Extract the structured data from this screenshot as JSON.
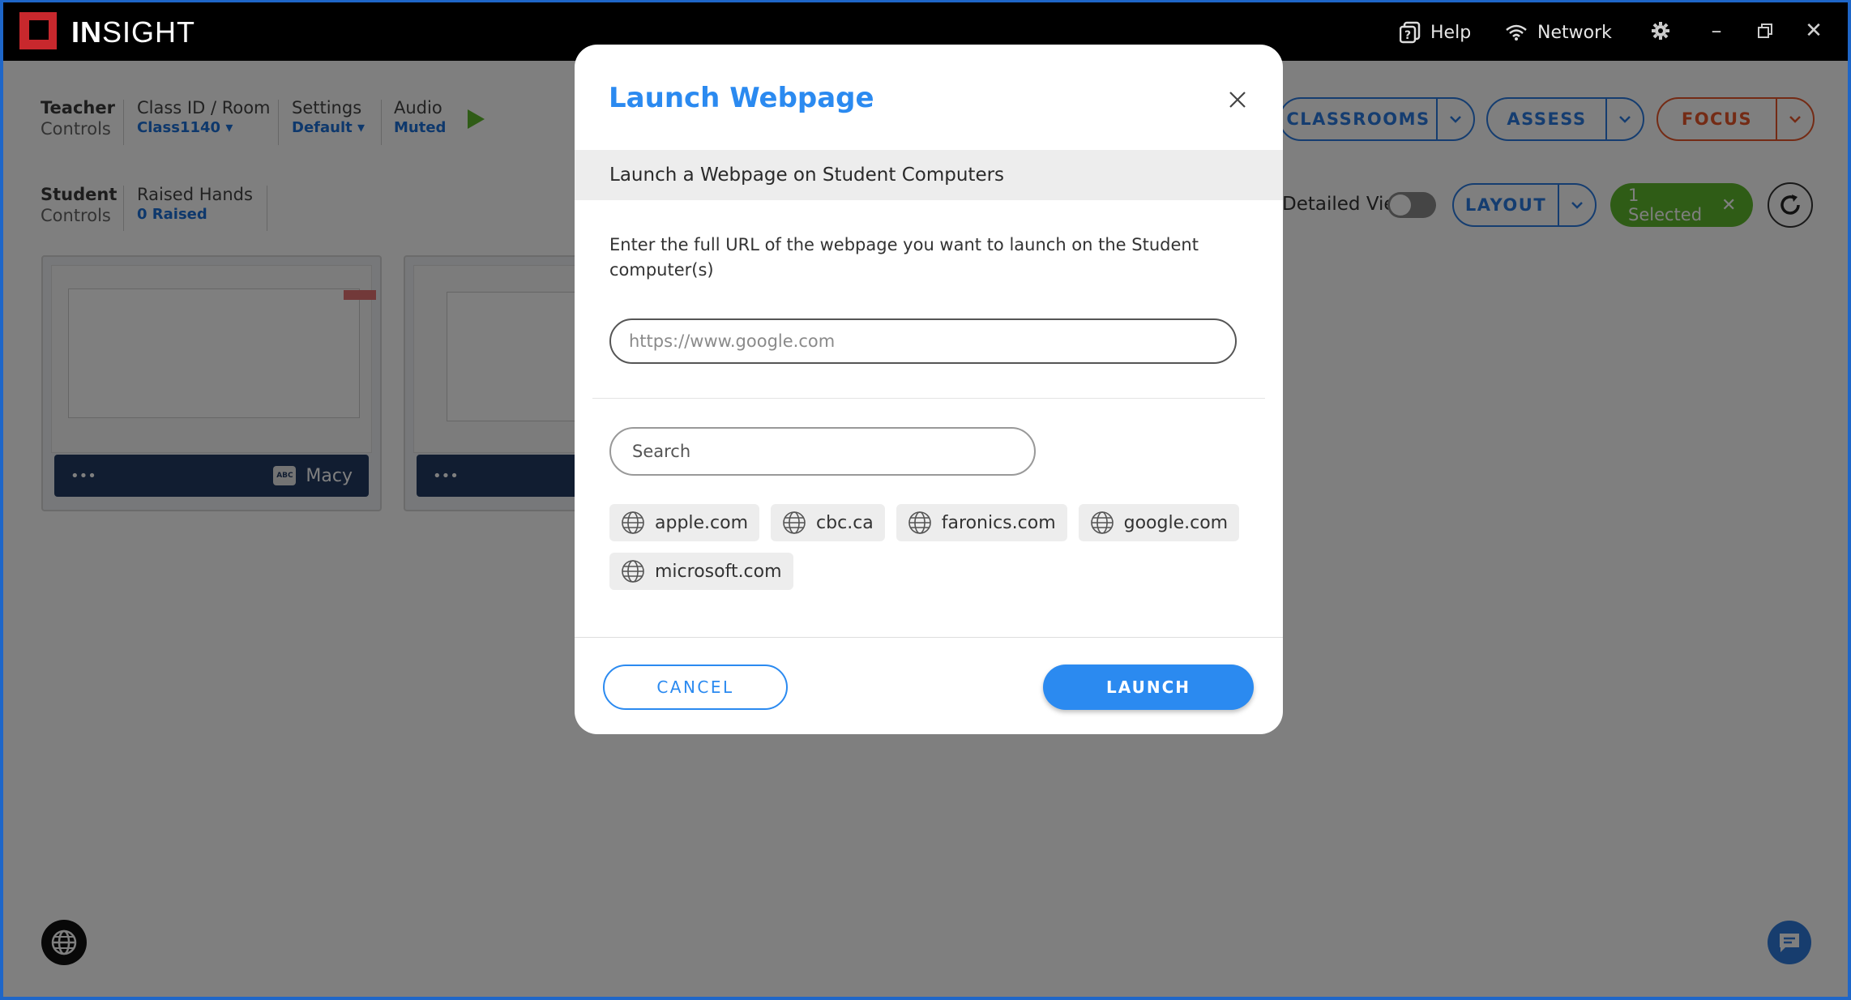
{
  "app": {
    "name_bold": "IN",
    "name_rest": "SIGHT",
    "help_label": "Help",
    "network_label": "Network"
  },
  "teacher_controls": {
    "title_bold": "Teacher",
    "title_light": "Controls",
    "class_label": "Class ID / Room",
    "class_value": "Class1140",
    "settings_label": "Settings",
    "settings_value": "Default",
    "audio_label": "Audio",
    "audio_value": "Muted"
  },
  "student_controls": {
    "title_bold": "Student",
    "title_light": "Controls",
    "raised_label": "Raised Hands",
    "raised_value": "0 Raised"
  },
  "toolbar": {
    "classrooms": "CLASSROOMS",
    "assess": "ASSESS",
    "focus": "FOCUS",
    "detailed_view": "Detailed View",
    "detailed_view_on": false,
    "layout": "LAYOUT",
    "selected": "1 Selected"
  },
  "students": [
    {
      "name": "Macy",
      "menu": "•••"
    },
    {
      "name": "",
      "menu": "•••"
    }
  ],
  "modal": {
    "title": "Launch Webpage",
    "subtitle": "Launch a Webpage on Student Computers",
    "description": "Enter the full URL of the webpage you want to launch on the Student computer(s)",
    "url_placeholder": "https://www.google.com",
    "url_value": "",
    "search_placeholder": "Search",
    "sites": [
      "apple.com",
      "cbc.ca",
      "faronics.com",
      "google.com",
      "microsoft.com"
    ],
    "cancel": "CANCEL",
    "launch": "LAUNCH"
  },
  "colors": {
    "accent": "#2b8af0",
    "brand": "#c8282d",
    "focus": "#e9572a",
    "selected": "#5fb82d",
    "overlay": "rgba(0,0,0,0.5)"
  },
  "icons": [
    "help-icon",
    "wifi-icon",
    "gear-icon",
    "minimize-icon",
    "restore-icon",
    "close-icon",
    "play-icon",
    "chevron-down-icon",
    "refresh-icon",
    "globe-icon",
    "chat-icon"
  ]
}
